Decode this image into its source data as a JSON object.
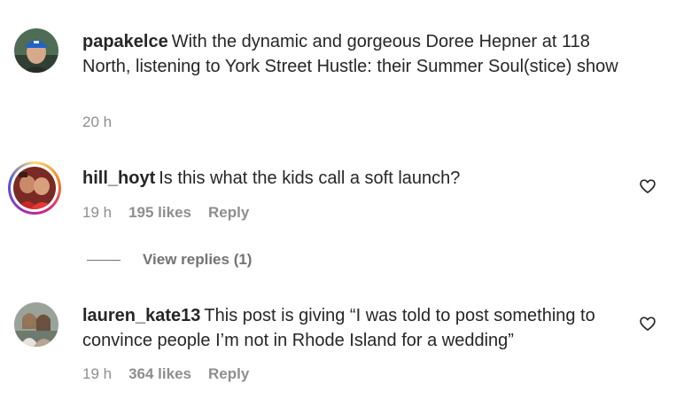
{
  "comments": [
    {
      "username": "papakelce",
      "text": "With the dynamic and gorgeous Doree Hepner at 118 North, listening to York Street Hustle: their Summer Soul(stice) show",
      "time": "20 h"
    },
    {
      "username": "hill_hoyt",
      "text": "Is this what the kids call a soft launch?",
      "time": "19 h",
      "likes": "195 likes",
      "reply_label": "Reply"
    },
    {
      "username": "lauren_kate13",
      "text": "This post is giving “I was told to post something to convince people I’m not in Rhode Island for a wedding”",
      "time": "19 h",
      "likes": "364 likes",
      "reply_label": "Reply"
    }
  ],
  "view_replies": "View replies (1)",
  "icons": {
    "like": "heart-icon"
  },
  "colors": {
    "text": "#262626",
    "muted": "#8e8e8e"
  }
}
